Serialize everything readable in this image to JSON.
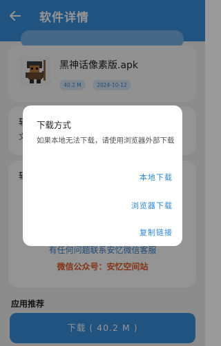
{
  "header": {
    "title": "软件详情"
  },
  "app": {
    "name": "黑神话像素版.apk",
    "size": "40.2 M",
    "date": "2024-10-12"
  },
  "sections": {
    "first_title": "软",
    "first_text": "文",
    "second_title": "软",
    "notice_line1": "有任何问题联系安忆微信客服",
    "notice_line2": "微信公众号：安忆空间站",
    "third_title": "应用推荐"
  },
  "download_button": {
    "label": "下载 ( 40.2 M )"
  },
  "dialog": {
    "title": "下载方式",
    "message": "如果本地无法下载，请使用浏览器外部下载",
    "options": [
      "本地下载",
      "浏览器下载",
      "复制链接"
    ]
  },
  "colors": {
    "accent": "#3a8fde",
    "highlight": "#e35b2b"
  },
  "icons": {
    "back": "back-arrow-icon"
  }
}
